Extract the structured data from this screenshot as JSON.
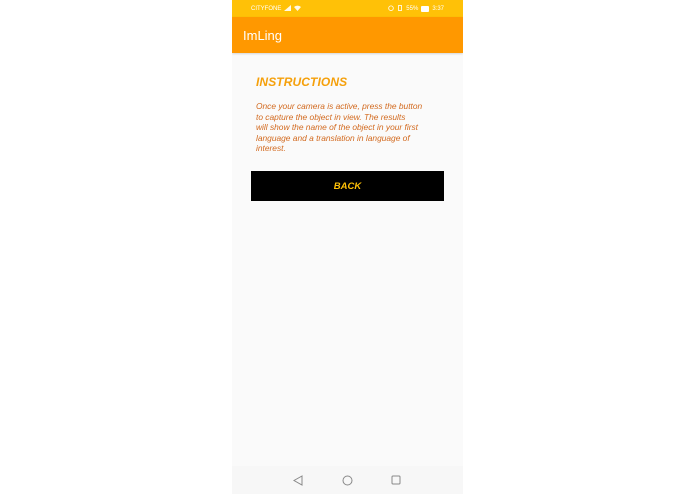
{
  "status_bar": {
    "carrier": "CITYFONE",
    "battery": "55%",
    "time": "3:37"
  },
  "app_bar": {
    "title": "ImLing"
  },
  "instructions": {
    "heading": "INSTRUCTIONS",
    "lines": [
      "Once your camera is active, press the button",
      "to capture the object in view. The results",
      "will show the name of the object in your first",
      "language and a translation in language of",
      "interest."
    ]
  },
  "back_button": {
    "label": "BACK"
  },
  "colors": {
    "status_bar": "#ffc107",
    "app_bar": "#ff9800",
    "heading": "#f5a00b",
    "body_text": "#d2691e",
    "button_bg": "#000000",
    "button_text": "#ffc107"
  },
  "icons": {
    "signal": "signal-icon",
    "wifi": "wifi-icon",
    "alarm": "alarm-icon",
    "vibrate": "vibrate-icon",
    "battery": "battery-icon",
    "nav_back": "triangle-back-icon",
    "nav_home": "circle-home-icon",
    "nav_recent": "square-recent-icon"
  }
}
